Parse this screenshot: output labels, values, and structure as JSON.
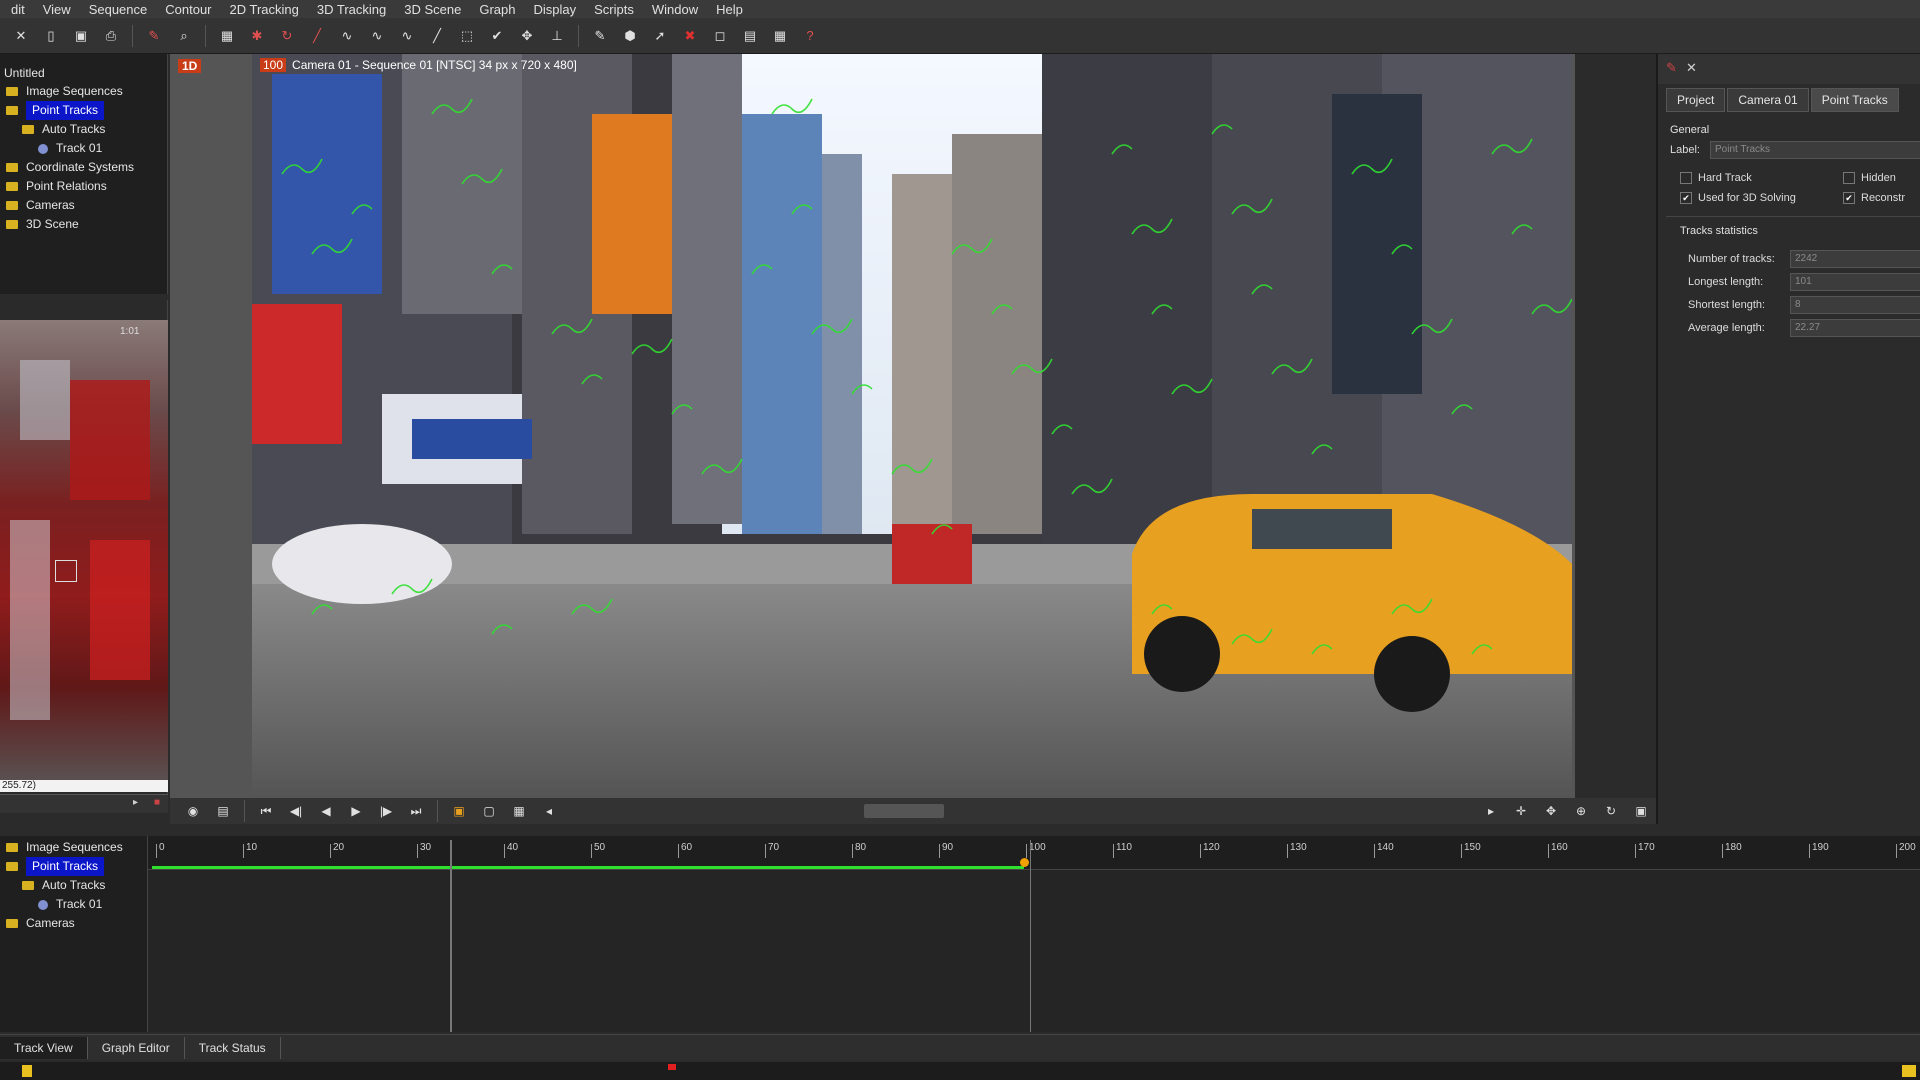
{
  "menu": [
    "dit",
    "View",
    "Sequence",
    "Contour",
    "2D Tracking",
    "3D Tracking",
    "3D Scene",
    "Graph",
    "Display",
    "Scripts",
    "Window",
    "Help"
  ],
  "toolbar_icons": [
    "close-icon",
    "new-file-icon",
    "save-icon",
    "print-icon",
    "brush-icon",
    "search-icon",
    "film-icon",
    "track-tool-icon",
    "refresh-icon",
    "line-tool-icon",
    "curve-tool-icon",
    "curve-tool-2-icon",
    "curve-tool-3-icon",
    "line-tool-2-icon",
    "select-tool-icon",
    "check-tool-icon",
    "move-tool-icon",
    "axis-icon",
    "pin-icon",
    "cube-icon",
    "arrow-icon",
    "x-icon",
    "window-icon",
    "layout-icon",
    "grid-icon",
    "help-icon"
  ],
  "left_tree": {
    "title": "Untitled",
    "items": [
      {
        "label": "Image Sequences",
        "type": "folder",
        "indent": 0,
        "selected": false
      },
      {
        "label": "Point Tracks",
        "type": "folder",
        "indent": 0,
        "selected": true
      },
      {
        "label": "Auto Tracks",
        "type": "folder",
        "indent": 1,
        "selected": false
      },
      {
        "label": "Track 01",
        "type": "track",
        "indent": 2,
        "selected": false
      },
      {
        "label": "Coordinate Systems",
        "type": "folder",
        "indent": 0,
        "selected": false
      },
      {
        "label": "Point Relations",
        "type": "folder",
        "indent": 0,
        "selected": false
      },
      {
        "label": "Cameras",
        "type": "folder",
        "indent": 0,
        "selected": false
      },
      {
        "label": "3D Scene",
        "type": "folder",
        "indent": 0,
        "selected": false
      }
    ]
  },
  "thumb": {
    "zoom_label": "1:01",
    "coords": "255.72)"
  },
  "viewer": {
    "badge": "1D",
    "frame_badge": "100",
    "title": "Camera 01 - Sequence 01 [NTSC] 34 px x 720 x 480]"
  },
  "right_panel": {
    "tabs": [
      "Project",
      "Camera 01",
      "Point Tracks"
    ],
    "active_tab": 2,
    "general_title": "General",
    "label_caption": "Label:",
    "label_value": "Point Tracks",
    "hard_track": "Hard Track",
    "hidden": "Hidden",
    "used_for_solving": "Used for 3D Solving",
    "reconstruct": "Reconstr",
    "stats_title": "Tracks statistics",
    "stats": [
      {
        "label": "Number of tracks:",
        "value": "2242"
      },
      {
        "label": "Longest length:",
        "value": "101"
      },
      {
        "label": "Shortest length:",
        "value": "8"
      },
      {
        "label": "Average length:",
        "value": "22.27"
      }
    ]
  },
  "bottom_tree": [
    {
      "label": "Image Sequences",
      "type": "folder",
      "indent": 0,
      "selected": false
    },
    {
      "label": "Point Tracks",
      "type": "folder",
      "indent": 0,
      "selected": true
    },
    {
      "label": "Auto Tracks",
      "type": "folder",
      "indent": 1,
      "selected": false
    },
    {
      "label": "Track 01",
      "type": "track",
      "indent": 2,
      "selected": false
    },
    {
      "label": "Cameras",
      "type": "folder",
      "indent": 0,
      "selected": false
    }
  ],
  "timeline": {
    "ticks": [
      "0",
      "10",
      "20",
      "30",
      "40",
      "50",
      "60",
      "70",
      "80",
      "90",
      "100",
      "110",
      "120",
      "130",
      "140",
      "150",
      "160",
      "170",
      "180",
      "190",
      "200"
    ],
    "current_frame": 100
  },
  "bottom_tabs": [
    "Track View",
    "Graph Editor",
    "Track Status"
  ],
  "colors": {
    "selection": "#0a16c8",
    "folder": "#d8b120",
    "track_line": "#2fe02f",
    "accent": "#c83c18"
  }
}
